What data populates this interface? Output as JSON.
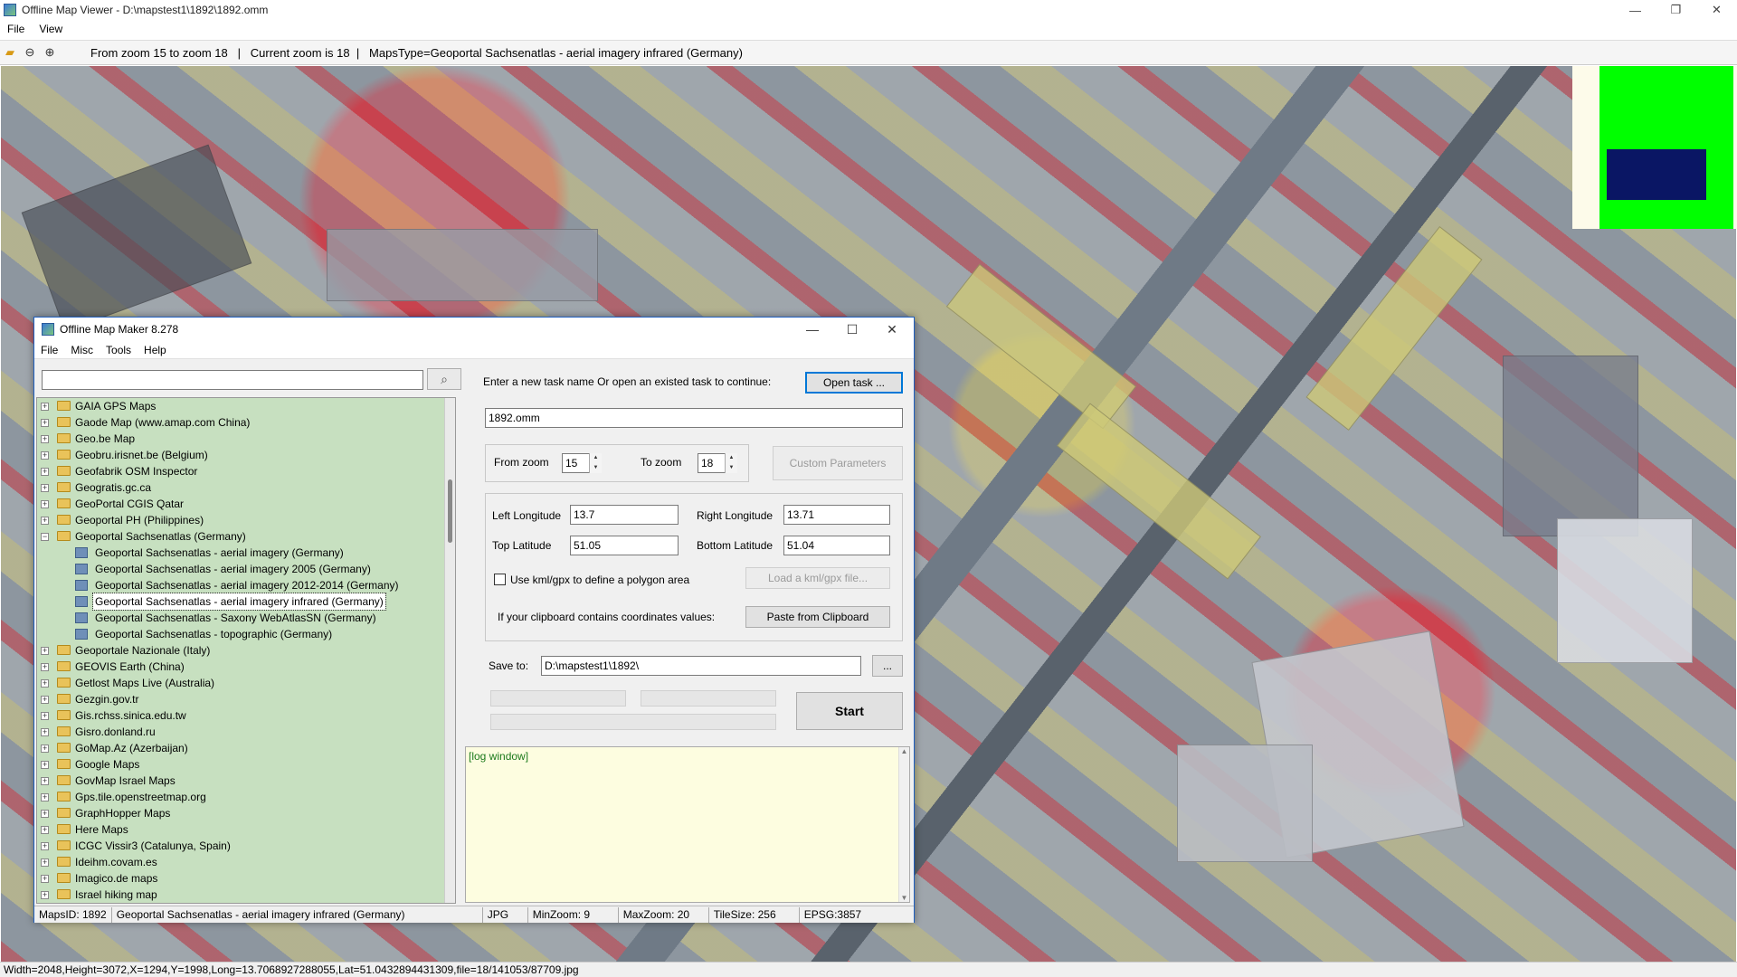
{
  "viewer": {
    "title": "Offline Map Viewer - D:\\mapstest1\\1892\\1892.omm",
    "menu": [
      "File",
      "View"
    ],
    "toolbar_text": "From zoom 15 to zoom 18   |   Current zoom is 18  |   MapsType=Geoportal Sachsenatlas - aerial imagery infrared (Germany)",
    "status": "Width=2048,Height=3072,X=1294,Y=1998,Long=13.7068927288055,Lat=51.0432894431309,file=18/141053/87709.jpg"
  },
  "dialog": {
    "title": "Offline Map Maker 8.278",
    "menu": [
      "File",
      "Misc",
      "Tools",
      "Help"
    ],
    "search_value": "",
    "tree": [
      {
        "label": "GAIA GPS Maps",
        "expander": "+",
        "type": "folder"
      },
      {
        "label": "Gaode Map (www.amap.com China)",
        "expander": "+",
        "type": "folder"
      },
      {
        "label": "Geo.be Map",
        "expander": "+",
        "type": "folder"
      },
      {
        "label": "Geobru.irisnet.be (Belgium)",
        "expander": "+",
        "type": "folder"
      },
      {
        "label": "Geofabrik OSM Inspector",
        "expander": "+",
        "type": "folder"
      },
      {
        "label": "Geogratis.gc.ca",
        "expander": "+",
        "type": "folder"
      },
      {
        "label": "GeoPortal CGIS Qatar",
        "expander": "+",
        "type": "folder"
      },
      {
        "label": "Geoportal PH (Philippines)",
        "expander": "+",
        "type": "folder"
      },
      {
        "label": "Geoportal Sachsenatlas (Germany)",
        "expander": "−",
        "type": "folder"
      },
      {
        "label": "Geoportal Sachsenatlas - aerial imagery (Germany)",
        "type": "map"
      },
      {
        "label": "Geoportal Sachsenatlas - aerial imagery 2005 (Germany)",
        "type": "map"
      },
      {
        "label": "Geoportal Sachsenatlas - aerial imagery 2012-2014 (Germany)",
        "type": "map"
      },
      {
        "label": "Geoportal Sachsenatlas - aerial imagery infrared (Germany)",
        "type": "map",
        "selected": true
      },
      {
        "label": "Geoportal Sachsenatlas - Saxony WebAtlasSN (Germany)",
        "type": "map"
      },
      {
        "label": "Geoportal Sachsenatlas - topographic (Germany)",
        "type": "map"
      },
      {
        "label": "Geoportale Nazionale (Italy)",
        "expander": "+",
        "type": "folder"
      },
      {
        "label": "GEOVIS Earth (China)",
        "expander": "+",
        "type": "folder"
      },
      {
        "label": "Getlost Maps Live (Australia)",
        "expander": "+",
        "type": "folder"
      },
      {
        "label": "Gezgin.gov.tr",
        "expander": "+",
        "type": "folder"
      },
      {
        "label": "Gis.rchss.sinica.edu.tw",
        "expander": "+",
        "type": "folder"
      },
      {
        "label": "Gisro.donland.ru",
        "expander": "+",
        "type": "folder"
      },
      {
        "label": "GoMap.Az (Azerbaijan)",
        "expander": "+",
        "type": "folder"
      },
      {
        "label": "Google Maps",
        "expander": "+",
        "type": "folder"
      },
      {
        "label": "GovMap Israel Maps",
        "expander": "+",
        "type": "folder"
      },
      {
        "label": "Gps.tile.openstreetmap.org",
        "expander": "+",
        "type": "folder"
      },
      {
        "label": "GraphHopper Maps",
        "expander": "+",
        "type": "folder"
      },
      {
        "label": "Here Maps",
        "expander": "+",
        "type": "folder"
      },
      {
        "label": "ICGC Vissir3 (Catalunya, Spain)",
        "expander": "+",
        "type": "folder"
      },
      {
        "label": "Ideihm.covam.es",
        "expander": "+",
        "type": "folder"
      },
      {
        "label": "Imagico.de maps",
        "expander": "+",
        "type": "folder"
      },
      {
        "label": "Israel hiking map",
        "expander": "+",
        "type": "folder"
      }
    ],
    "task_prompt": "Enter a new task name Or open an existed task to continue:",
    "open_task_label": "Open task ...",
    "task_name": "1892.omm",
    "from_zoom_label": "From zoom",
    "from_zoom": "15",
    "to_zoom_label": "To zoom",
    "to_zoom": "18",
    "custom_params_label": "Custom Parameters",
    "left_lon_label": "Left Longitude",
    "left_lon": "13.7",
    "right_lon_label": "Right Longitude",
    "right_lon": "13.71",
    "top_lat_label": "Top Latitude",
    "top_lat": "51.05",
    "bottom_lat_label": "Bottom Latitude",
    "bottom_lat": "51.04",
    "kml_label": "Use kml/gpx to define a polygon area",
    "load_kml_label": "Load a kml/gpx file...",
    "clipboard_prompt": "If your clipboard contains coordinates values:",
    "paste_label": "Paste from Clipboard",
    "save_to_label": "Save to:",
    "save_path": "D:\\mapstest1\\1892\\",
    "browse_label": "...",
    "start_label": "Start",
    "log_text": "[log window]",
    "status": {
      "maps_id": "MapsID: 1892",
      "map_name": "Geoportal Sachsenatlas - aerial imagery infrared (Germany)",
      "format": "JPG",
      "min_zoom": "MinZoom: 9",
      "max_zoom": "MaxZoom: 20",
      "tile_size": "TileSize: 256",
      "epsg": "EPSG:3857"
    }
  }
}
